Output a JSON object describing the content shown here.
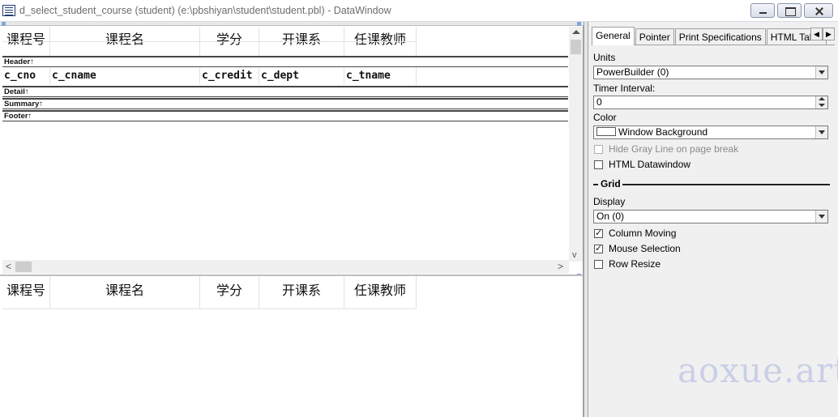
{
  "window": {
    "title": "d_select_student_course  (student) (e:\\pbshiyan\\student\\student.pbl) - DataWindow"
  },
  "design": {
    "headers": [
      "课程号",
      "课程名",
      "学分",
      "开课系",
      "任课教师"
    ],
    "bands": [
      "Header↑",
      "Detail↑",
      "Summary↑",
      "Footer↑"
    ],
    "columns": [
      "c_cno",
      "c_cname",
      "c_credit",
      "c_dept",
      "c_tname"
    ],
    "hscroll": {
      "left_arrow": "<",
      "right_arrow": ">"
    },
    "vscroll": {
      "down_arrow": "v"
    }
  },
  "preview": {
    "headers": [
      "课程号",
      "课程名",
      "学分",
      "开课系",
      "任课教师"
    ]
  },
  "properties": {
    "tabs": [
      "General",
      "Pointer",
      "Print Specifications",
      "HTML Table"
    ],
    "tab_scroll": {
      "left": "◀",
      "right": "▶"
    },
    "units_label": "Units",
    "units_value": "PowerBuilder (0)",
    "timer_label": "Timer Interval:",
    "timer_value": "0",
    "color_label": "Color",
    "color_value": "Window Background",
    "hide_gray_line": {
      "label": "Hide Gray Line on page break",
      "checked": false,
      "enabled": false
    },
    "html_datawindow": {
      "label": "HTML Datawindow",
      "checked": false
    },
    "grid_group": "Grid",
    "display_label": "Display",
    "display_value": "On (0)",
    "column_moving": {
      "label": "Column Moving",
      "checked": true
    },
    "mouse_selection": {
      "label": "Mouse Selection",
      "checked": true
    },
    "row_resize": {
      "label": "Row Resize",
      "checked": false
    }
  },
  "watermark": "aoxue.art"
}
